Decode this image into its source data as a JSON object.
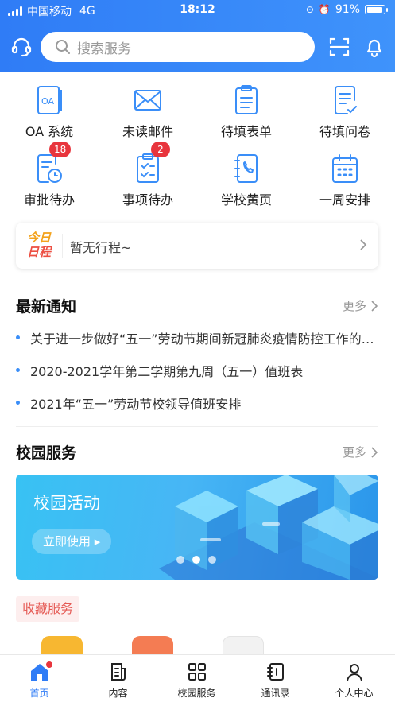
{
  "status_bar": {
    "carrier": "中国移动",
    "network": "4G",
    "time": "18:12",
    "battery": "91%"
  },
  "header": {
    "search_placeholder": "搜索服务"
  },
  "grid": [
    {
      "label": "OA 系统",
      "icon": "oa-icon"
    },
    {
      "label": "未读邮件",
      "icon": "mail-icon"
    },
    {
      "label": "待填表单",
      "icon": "form-icon"
    },
    {
      "label": "待填问卷",
      "icon": "survey-icon"
    },
    {
      "label": "审批待办",
      "icon": "approval-icon",
      "badge": "18"
    },
    {
      "label": "事项待办",
      "icon": "task-icon",
      "badge": "2"
    },
    {
      "label": "学校黄页",
      "icon": "phonebook-icon"
    },
    {
      "label": "一周安排",
      "icon": "calendar-icon"
    }
  ],
  "schedule": {
    "logo_line1": "今日",
    "logo_line2": "日程",
    "text": "暂无行程~"
  },
  "notices": {
    "title": "最新通知",
    "more": "更多",
    "items": [
      "关于进一步做好“五一”劳动节期间新冠肺炎疫情防控工作的通知",
      "2020-2021学年第二学期第九周（五一）值班表",
      "2021年“五一”劳动节校领导值班安排"
    ]
  },
  "campus": {
    "title": "校园服务",
    "more": "更多",
    "banner_title": "校园活动",
    "banner_button": "立即使用 ▸"
  },
  "favorites": {
    "title": "收藏服务"
  },
  "tabs": [
    {
      "label": "首页",
      "icon": "home-icon"
    },
    {
      "label": "内容",
      "icon": "content-icon"
    },
    {
      "label": "校园服务",
      "icon": "grid-services-icon"
    },
    {
      "label": "通讯录",
      "icon": "contacts-icon"
    },
    {
      "label": "个人中心",
      "icon": "user-icon"
    }
  ],
  "colors": {
    "accent": "#2f7cf6",
    "badge": "#e8353d",
    "fav_tag": "#e55a55"
  }
}
